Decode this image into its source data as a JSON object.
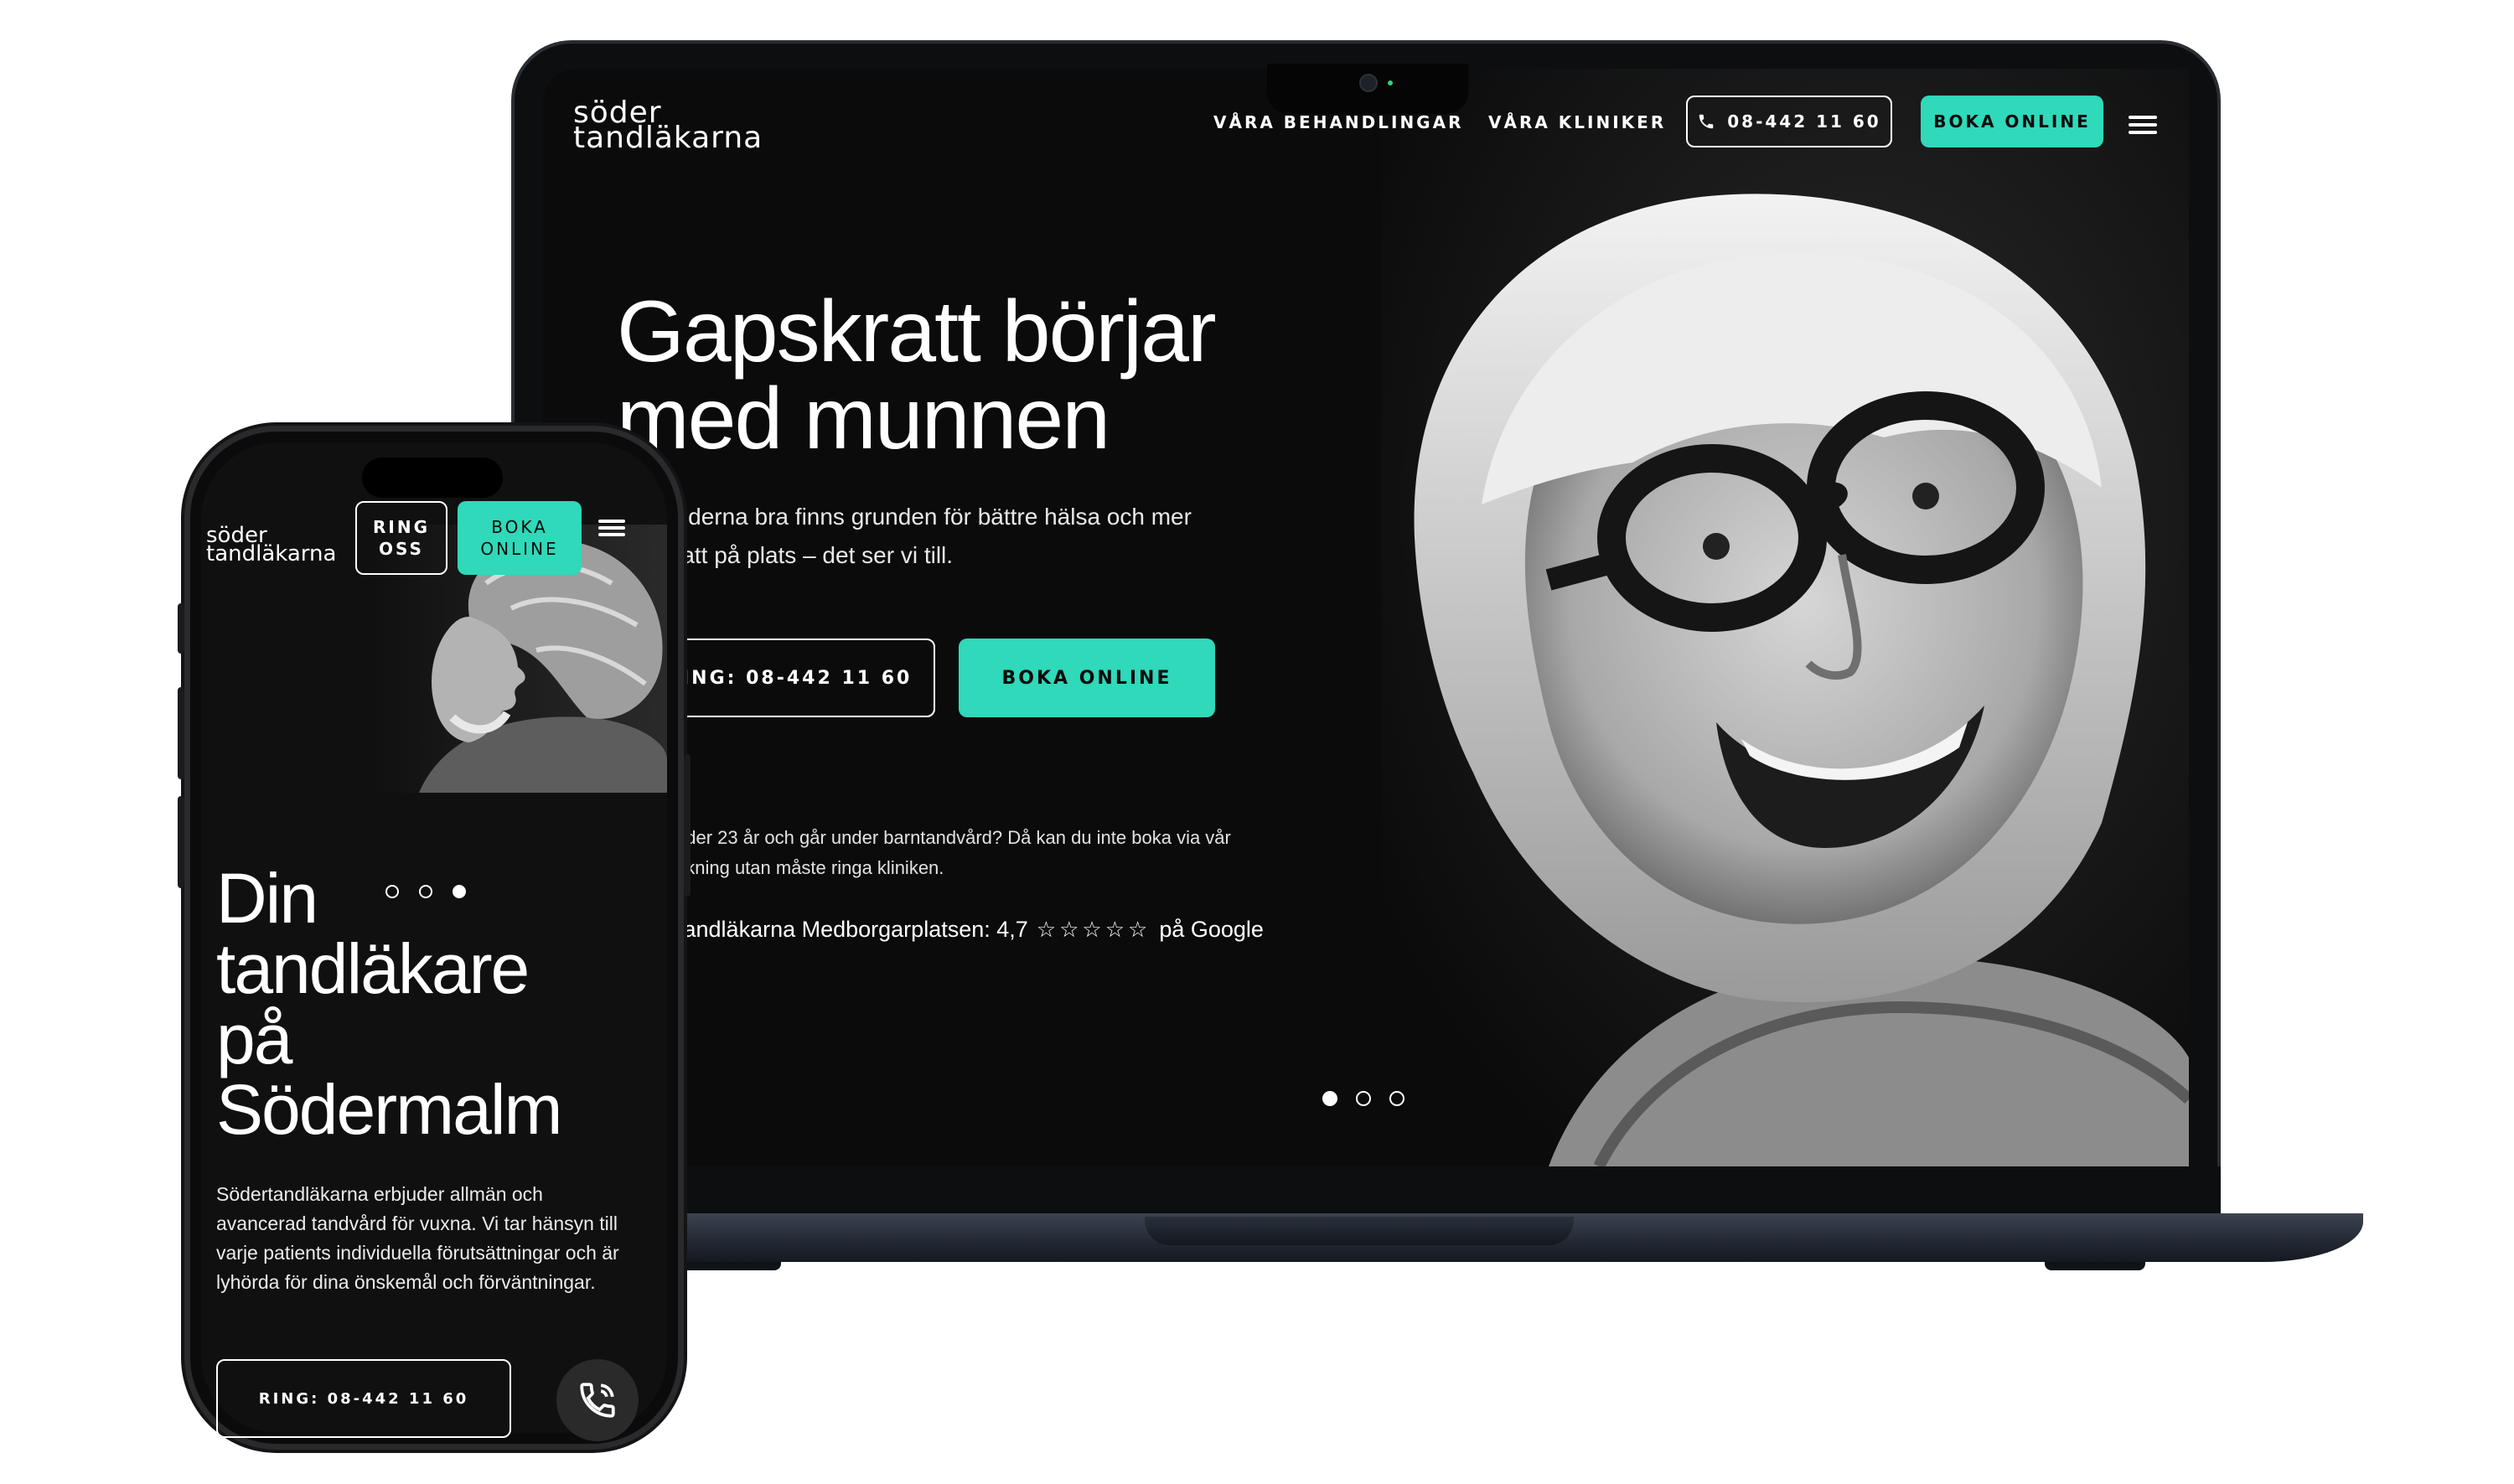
{
  "brand": {
    "logo_line1": "söder",
    "logo_line2": "tandläkarna",
    "accent": "#2fd9b9"
  },
  "laptop": {
    "nav": {
      "item1": "VÅRA BEHANDLINGAR",
      "item2": "VÅRA KLINIKER",
      "phone_label": "08-442 11 60",
      "book_label": "BOKA ONLINE"
    },
    "hero": {
      "headline_line1": "Gapskratt börjar",
      "headline_line2": "med munnen",
      "lead_line1": "änderna bra finns grunden för bättre hälsa och mer",
      "lead_line2": "kratt på plats – det ser vi till.",
      "ring_label": "ING: 08-442 11 60",
      "book_label": "BOKA ONLINE",
      "note_line1": "nder 23 år och går under barntandvård? Då kan du inte boka via vår",
      "note_line2": "okning utan måste ringa kliniken.",
      "rating_prefix": "tandläkarna Medborgarplatsen: 4,7",
      "rating_stars": "☆☆☆☆☆",
      "rating_suffix": "på Google"
    }
  },
  "phone": {
    "header": {
      "ring_label": "RING OSS",
      "book_label": "BOKA ONLINE"
    },
    "hero": {
      "headline_line1": "Din",
      "headline_line2": "tandläkare",
      "headline_line3": "på",
      "headline_line4": "Södermalm",
      "body": "Södertandläkarna erbjuder allmän och avancerad tandvård för vuxna. Vi tar hänsyn till varje patients individuella förutsättningar och är lyhörda för dina önskemål och förväntningar.",
      "ring_button": "RING: 08-442 11 60"
    }
  }
}
